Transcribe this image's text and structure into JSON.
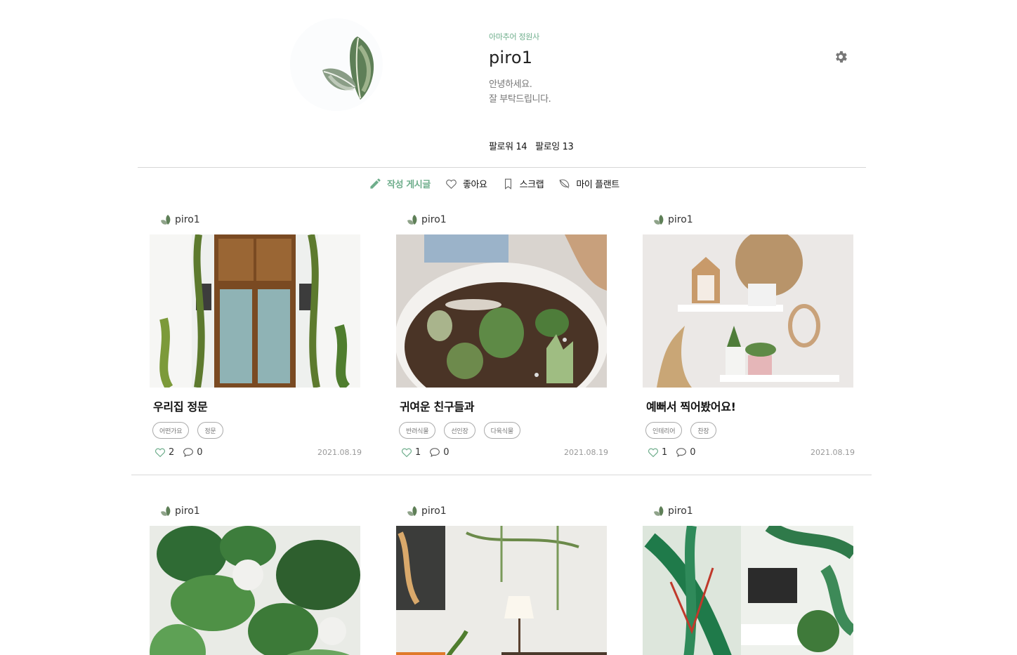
{
  "profile": {
    "grade": "아마추어 정원사",
    "username": "piro1",
    "bio_line1": "안녕하세요.",
    "bio_line2": "잘 부탁드립니다.",
    "followers": "팔로워 14",
    "following": "팔로잉 13"
  },
  "tabs": [
    {
      "label": "작성 게시글",
      "icon": "pencil-icon",
      "active": true
    },
    {
      "label": "좋아요",
      "icon": "heart-icon",
      "active": false
    },
    {
      "label": "스크랩",
      "icon": "bookmark-icon",
      "active": false
    },
    {
      "label": "마이 플랜트",
      "icon": "leaf-icon",
      "active": false
    }
  ],
  "colors": {
    "accent": "#6fae8c",
    "divider": "#d6d6d6",
    "date": "#999999"
  },
  "posts": [
    {
      "author": "piro1",
      "title": "우리집 정문",
      "tags": [
        "어떤가요",
        "정문"
      ],
      "likes": "2",
      "comments": "0",
      "date": "2021.08.19",
      "image": "door-with-ivy"
    },
    {
      "author": "piro1",
      "title": "귀여운 친구들과",
      "tags": [
        "반려식물",
        "선인장",
        "다육식물"
      ],
      "likes": "1",
      "comments": "0",
      "date": "2021.08.19",
      "image": "cactus-bowl"
    },
    {
      "author": "piro1",
      "title": "예뻐서 찍어봤어요!",
      "tags": [
        "인테리어",
        "찬장"
      ],
      "likes": "1",
      "comments": "0",
      "date": "2021.08.19",
      "image": "shelf-decor"
    },
    {
      "author": "piro1",
      "image": "monstera-plants"
    },
    {
      "author": "piro1",
      "image": "living-room-lamp"
    },
    {
      "author": "piro1",
      "image": "tropical-leaf-room"
    }
  ]
}
